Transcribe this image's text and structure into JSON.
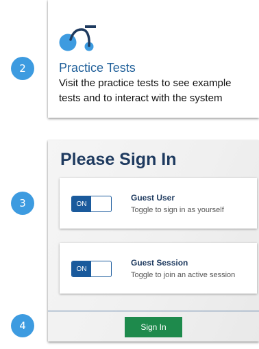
{
  "steps": [
    "2",
    "3",
    "4"
  ],
  "practice": {
    "icon": "tricycle-icon",
    "title": "Practice Tests",
    "description": "Visit the practice tests to see example tests and to interact with the system"
  },
  "signin": {
    "title": "Please Sign In",
    "options": [
      {
        "toggle_label": "ON",
        "toggle_state": "on",
        "title": "Guest User",
        "description": "Toggle to sign in as yourself"
      },
      {
        "toggle_label": "ON",
        "toggle_state": "on",
        "title": "Guest Session",
        "description": "Toggle to join an active session"
      }
    ],
    "button_label": "Sign In"
  },
  "colors": {
    "step_badge": "#3d9be0",
    "practice_title": "#1f5f99",
    "heading_navy": "#1e3a5f",
    "toggle_blue": "#1a5a9c",
    "signin_green": "#1e8a4c"
  }
}
